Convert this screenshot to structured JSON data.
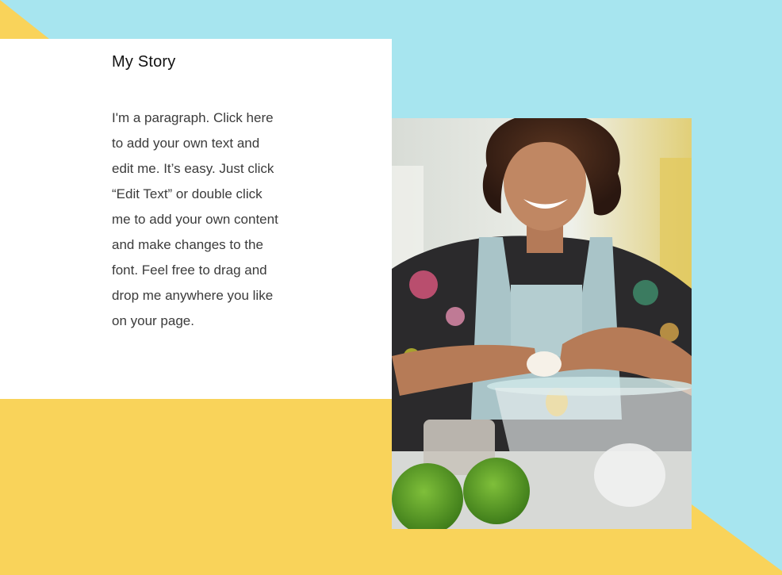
{
  "section": {
    "title": "My Story",
    "paragraph": "I'm a paragraph. Click here to add your own text and edit me. It’s easy. Just click “Edit Text” or double click me to add your own content and make changes to the font. Feel free to drag and drop me anywhere you like on your page."
  },
  "colors": {
    "sky": "#a7e5ef",
    "yellow": "#f9d35a",
    "card": "#ffffff",
    "text": "#3b3b3b"
  },
  "image": {
    "alt": "photo-woman-cracking-egg"
  }
}
